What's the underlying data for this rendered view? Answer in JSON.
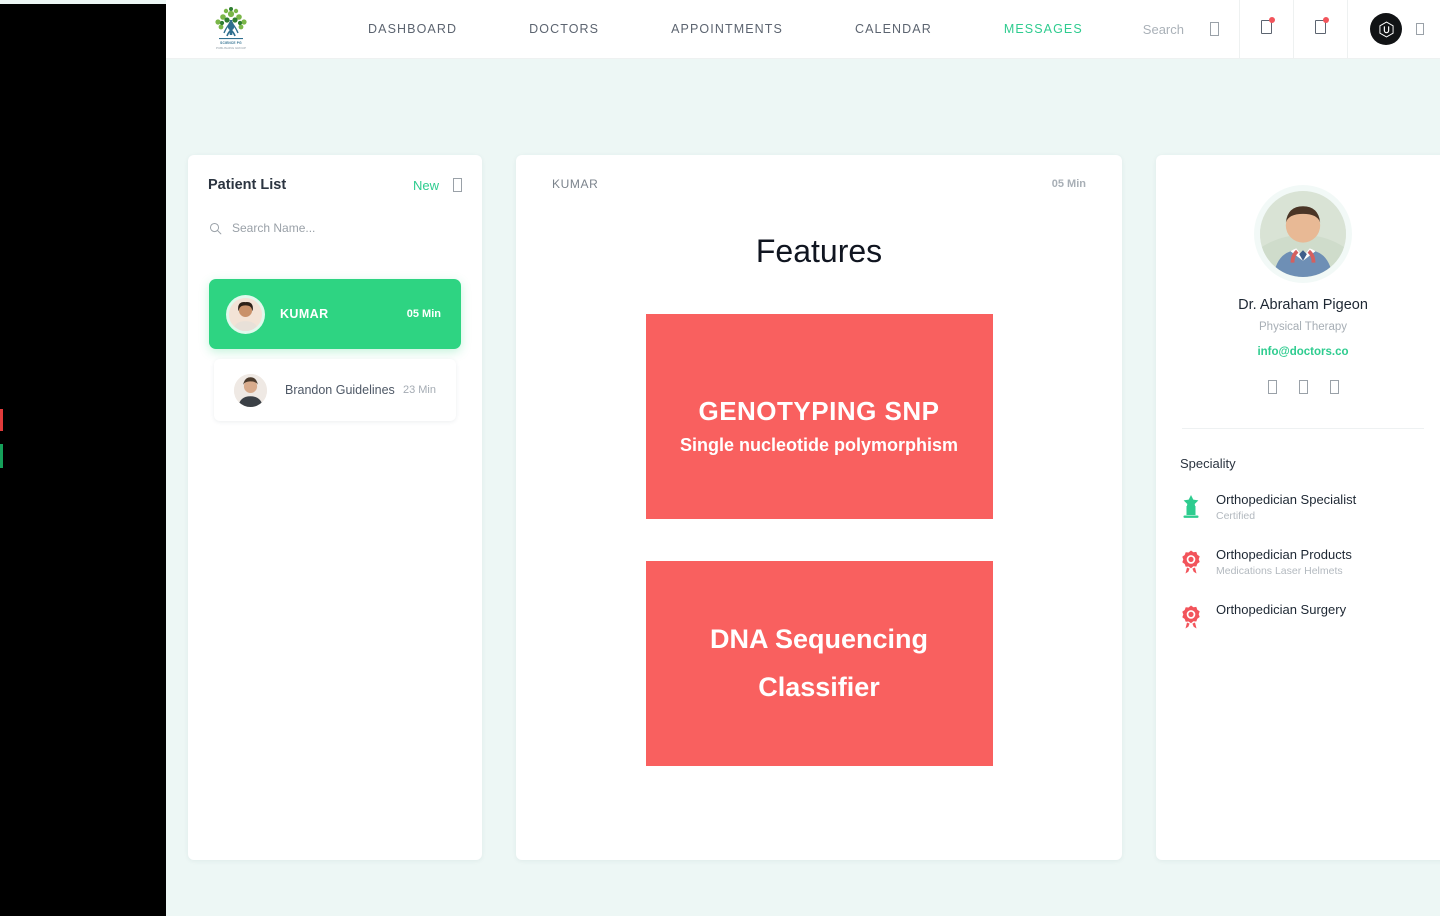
{
  "header": {
    "logo": {
      "name": "health-tree-logo",
      "line1": "SCIENCE PG",
      "line2": "PUBLISHING GROUP"
    },
    "nav": [
      {
        "label": "DASHBOARD",
        "active": false
      },
      {
        "label": "DOCTORS",
        "active": false
      },
      {
        "label": "APPOINTMENTS",
        "active": false
      },
      {
        "label": "CALENDAR",
        "active": false
      },
      {
        "label": "MESSAGES",
        "active": true
      }
    ],
    "search": {
      "label": "Search",
      "icon": "search-icon"
    },
    "icons": [
      {
        "name": "notifications-icon",
        "badge": true
      },
      {
        "name": "messages-icon",
        "badge": true
      }
    ],
    "user": {
      "avatar": "user-avatar",
      "caret": "chevron-down-icon"
    }
  },
  "patients": {
    "title": "Patient List",
    "new_label": "New",
    "new_icon": "add-square-icon",
    "search_placeholder": "Search Name...",
    "search_value": "",
    "items": [
      {
        "name": "KUMAR",
        "time": "05 Min",
        "active": true
      },
      {
        "name": "Brandon Guidelines",
        "time": "23 Min",
        "active": false
      }
    ]
  },
  "content": {
    "patient_name": "KUMAR",
    "time": "05 Min",
    "title": "Features",
    "cards": [
      {
        "line1": "GENOTYPING  SNP",
        "line2": "Single nucleotide polymorphism"
      },
      {
        "line1": "DNA Sequencing",
        "line2": "Classifier"
      }
    ]
  },
  "doctor": {
    "photo": "doctor-photo",
    "name": "Dr. Abraham Pigeon",
    "role": "Physical Therapy",
    "email": "info@doctors.co",
    "social": [
      "facebook-icon",
      "twitter-icon",
      "linkedin-icon"
    ],
    "speciality_title": "Speciality",
    "specialities": [
      {
        "label": "Orthopedician Specialist",
        "sub": "Certified",
        "icon": "award-trophy-icon",
        "color": "#2ecc8f"
      },
      {
        "label": "Orthopedician Products",
        "sub": "Medications Laser Helmets",
        "icon": "award-badge-icon",
        "color": "#f2545b"
      },
      {
        "label": "Orthopedician Surgery",
        "sub": "",
        "icon": "award-badge-icon",
        "color": "#f2545b"
      }
    ]
  },
  "colors": {
    "accent_green": "#2ed482",
    "nav_active": "#2ecc8f",
    "card_red": "#f9605f",
    "badge_red": "#f2545b",
    "background": "#edf7f5"
  }
}
